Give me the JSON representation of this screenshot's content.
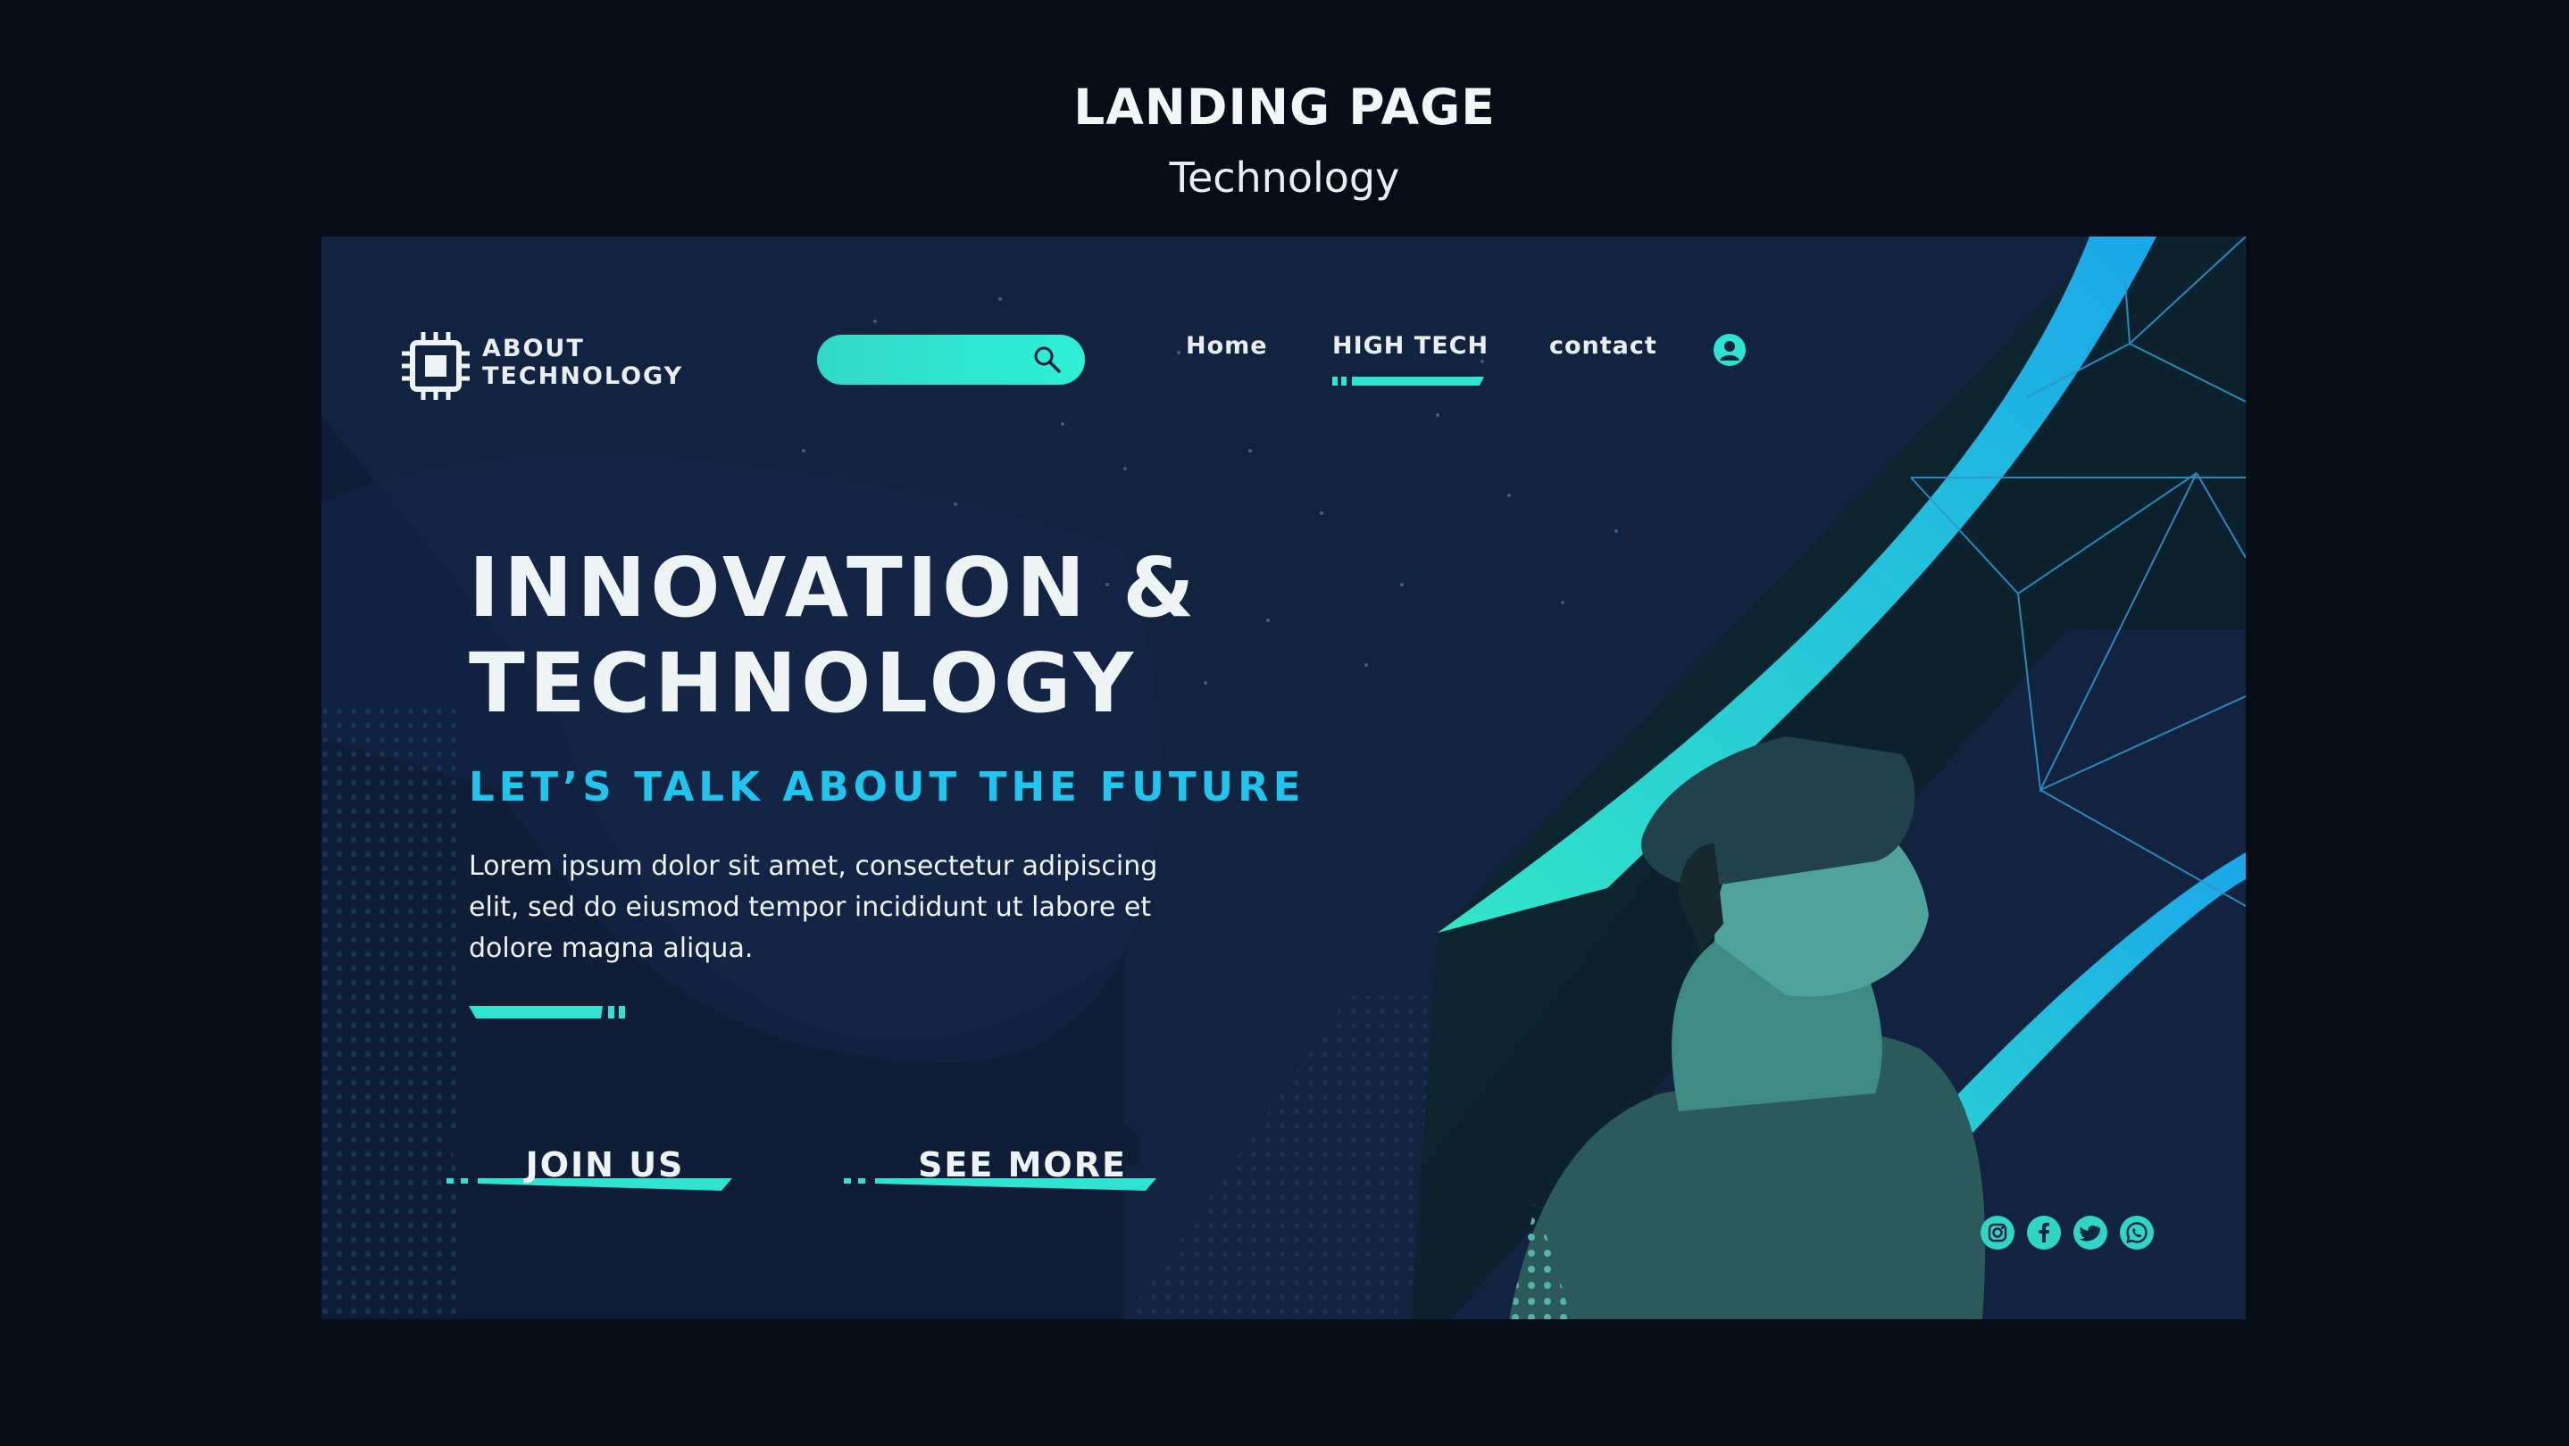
{
  "caption": {
    "title": "LANDING PAGE",
    "subtitle": "Technology"
  },
  "brand": {
    "logo_icon": "chip-icon",
    "line1": "ABOUT",
    "line2": "TECHNOLOGY"
  },
  "search": {
    "placeholder": "",
    "icon": "search-icon"
  },
  "nav": {
    "items": [
      {
        "label": "Home",
        "active": false
      },
      {
        "label": "HIGH TECH",
        "active": true
      },
      {
        "label": "contact",
        "active": false
      }
    ],
    "user_icon": "user-icon"
  },
  "hero": {
    "headline_line1": "INNOVATION &",
    "headline_line2": "TECHNOLOGY",
    "tagline": "LET’S TALK ABOUT THE FUTURE",
    "body_line1": "Lorem ipsum dolor sit amet, consectetur adipiscing",
    "body_line2": "elit, sed do eiusmod tempor incididunt ut labore et",
    "body_line3": "dolore magna aliqua."
  },
  "buttons": {
    "join": "JOIN US",
    "see_more": "SEE MORE"
  },
  "social": [
    "instagram-icon",
    "facebook-icon",
    "twitter-icon",
    "whatsapp-icon"
  ],
  "colors": {
    "page_bg": "#060d17",
    "panel_bg": "#122340",
    "accent_teal": "#2ee3cf",
    "accent_blue": "#20c5ee",
    "text": "#eef3f6"
  }
}
